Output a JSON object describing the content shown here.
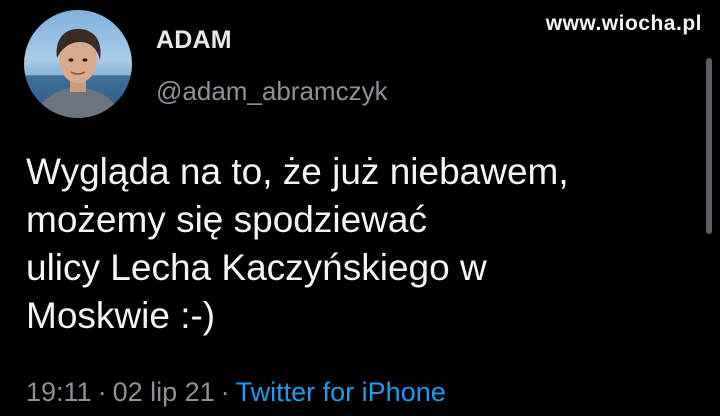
{
  "watermark": "www.wiocha.pl",
  "author": {
    "display_name": "ADAM",
    "handle": "@adam_abramczyk",
    "avatar_icon": "profile-photo"
  },
  "tweet": {
    "text": "Wygląda na to, że już niebawem,\nmożemy się spodziewać\nulicy Lecha Kaczyńskiego w\nMoskwie :-)"
  },
  "meta": {
    "time": "19:11",
    "separator": "·",
    "date": "02 lip 21",
    "client": "Twitter for iPhone"
  },
  "colors": {
    "background": "#000000",
    "secondary_text": "#8b9299",
    "link": "#1d9bf0"
  }
}
